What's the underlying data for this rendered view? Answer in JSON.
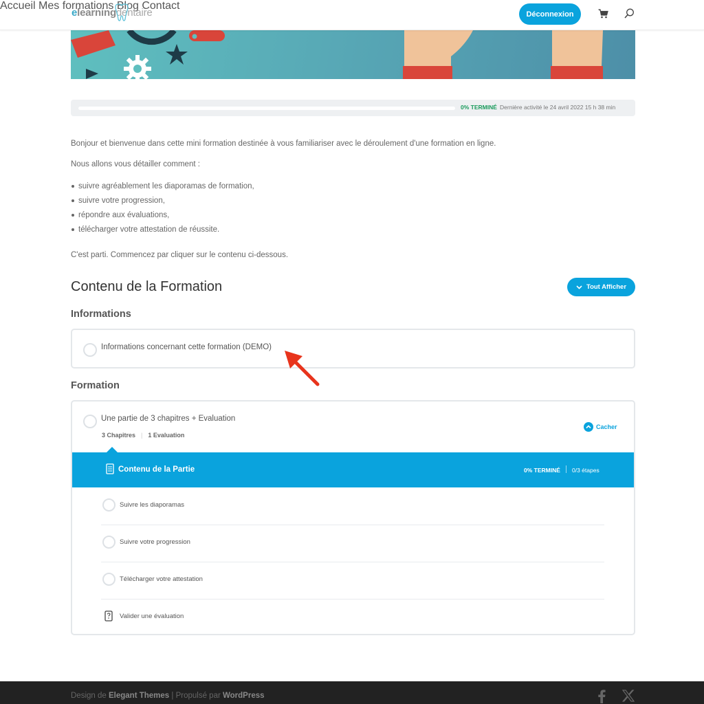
{
  "brand": {
    "logo_part1_e": "e",
    "logo_part1_rest": "learning",
    "logo_part2": "dentaire"
  },
  "nav": {
    "items": [
      "Accueil",
      "Mes formations",
      "Blog",
      "Contact"
    ],
    "logout_label": "Déconnexion",
    "icons": [
      "cart-icon",
      "search-icon"
    ]
  },
  "progress": {
    "percent_label": "0% TERMINÉ",
    "completion": 0.0,
    "last_activity": "Dernière activité le 24 avril 2022 15 h 38 min"
  },
  "intro": {
    "p1": "Bonjour et bienvenue dans cette mini formation destinée à vous familiariser avec le déroulement d'une formation en ligne.",
    "p2": "Nous allons vous détailler comment :",
    "bullets": [
      "suivre agréablement les diaporamas de formation,",
      "suivre votre progression,",
      "répondre aux évaluations,",
      "télécharger votre attestation de réussite."
    ],
    "p3": "C'est parti. Commencez par cliquer sur le contenu ci-dessous."
  },
  "course_content": {
    "title": "Contenu de la Formation",
    "expand_all_label": "Tout Afficher",
    "sections": [
      {
        "heading": "Informations",
        "items": [
          {
            "title": "Informations concernant cette formation (DEMO)"
          }
        ]
      },
      {
        "heading": "Formation",
        "items": [
          {
            "title": "Une partie de 3 chapitres + Evaluation",
            "chapters": "3 Chapitres",
            "evaluations": "1 Evaluation",
            "hide_label": "Cacher",
            "content_header": "Contenu de la Partie",
            "content_progress": "0% TERMINÉ",
            "content_steps": "0/3 étapes",
            "steps": [
              "Suivre les diaporamas",
              "Suivre votre progression",
              "Télécharger votre attestation",
              "Valider une évaluation"
            ]
          }
        ]
      }
    ]
  },
  "footer": {
    "design_prefix": "Design de",
    "design_brand": "Elegant Themes",
    "powered_prefix": "| Propulsé par",
    "powered_brand": "WordPress",
    "social_icons": [
      "facebook-icon",
      "x-icon"
    ]
  },
  "colors": {
    "accent": "#0aa3dd",
    "success": "#1a9b5c",
    "footer_bg": "#222222",
    "arrow": "#e8341c"
  }
}
